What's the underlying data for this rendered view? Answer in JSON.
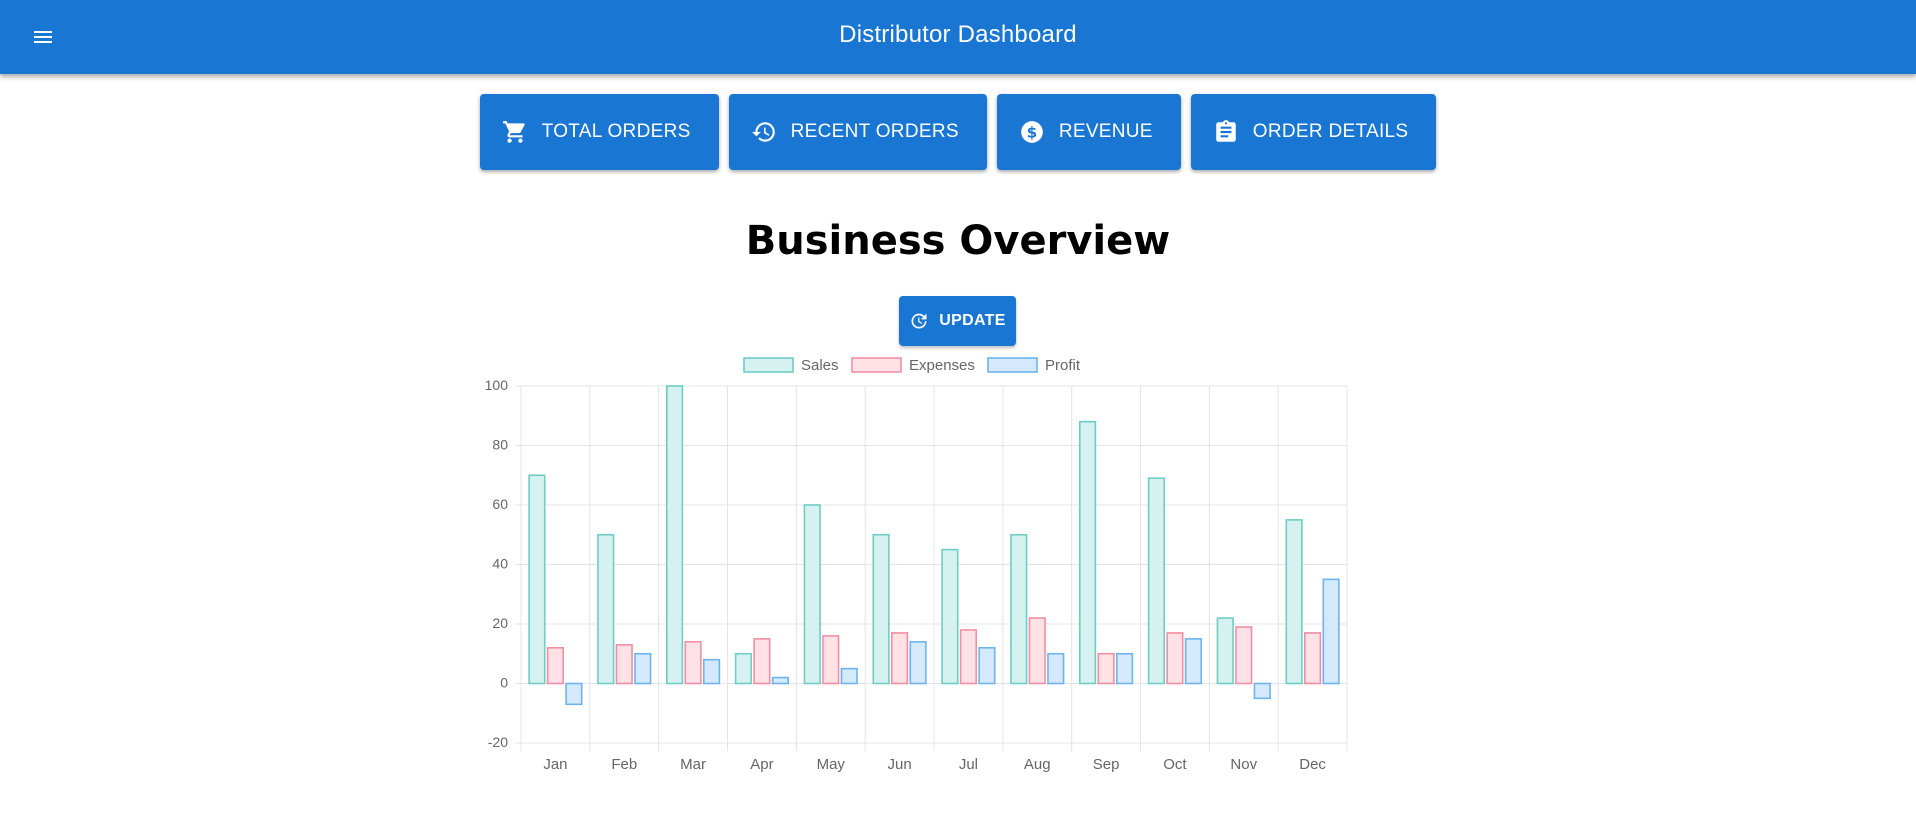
{
  "header": {
    "title": "Distributor Dashboard",
    "menu_icon": "menu-icon"
  },
  "nav": {
    "buttons": [
      {
        "label": "TOTAL ORDERS",
        "icon": "cart-icon"
      },
      {
        "label": "RECENT ORDERS",
        "icon": "history-icon"
      },
      {
        "label": "REVENUE",
        "icon": "dollar-icon"
      },
      {
        "label": "ORDER DETAILS",
        "icon": "clipboard-icon"
      }
    ]
  },
  "main": {
    "title": "Business Overview",
    "update_label": "UPDATE",
    "update_icon": "refresh-icon"
  },
  "colors": {
    "primary": "#1976d2",
    "sales_fill": "#d6f2f0",
    "sales_stroke": "#6ecdc5",
    "expenses_fill": "#ffe1e6",
    "expenses_stroke": "#f08fa3",
    "profit_fill": "#d4e9fb",
    "profit_stroke": "#6db4ec"
  },
  "chart_data": {
    "type": "bar",
    "categories": [
      "Jan",
      "Feb",
      "Mar",
      "Apr",
      "May",
      "Jun",
      "Jul",
      "Aug",
      "Sep",
      "Oct",
      "Nov",
      "Dec"
    ],
    "series": [
      {
        "name": "Sales",
        "values": [
          70,
          50,
          100,
          10,
          60,
          50,
          45,
          50,
          88,
          69,
          22,
          55
        ]
      },
      {
        "name": "Expenses",
        "values": [
          12,
          13,
          14,
          15,
          16,
          17,
          18,
          22,
          10,
          17,
          19,
          17
        ]
      },
      {
        "name": "Profit",
        "values": [
          -7,
          10,
          8,
          2,
          5,
          14,
          12,
          10,
          10,
          15,
          -5,
          35
        ]
      }
    ],
    "yticks": [
      100,
      80,
      60,
      40,
      20,
      0,
      -20
    ],
    "ylim": [
      -20,
      100
    ],
    "grid": true,
    "legend": "top-center"
  }
}
